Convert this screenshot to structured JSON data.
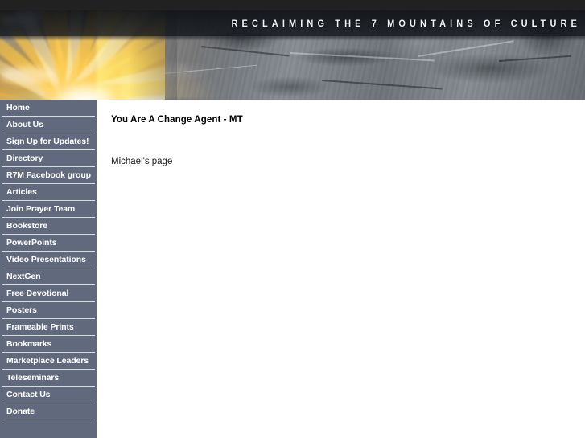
{
  "banner": {
    "headline": "RECLAIMING THE 7 MOUNTAINS OF CULTURE",
    "colors": {
      "topbar": "#212121",
      "rock": "#6d6f75",
      "sun": "#f0a93c",
      "band": "#101419"
    }
  },
  "sidebar": {
    "background_color": "#616a7d",
    "divider_color": "#d8dade",
    "text_color": "#ffffff",
    "items": [
      {
        "label": "Home"
      },
      {
        "label": "About Us"
      },
      {
        "label": "Sign Up for Updates!"
      },
      {
        "label": "Directory"
      },
      {
        "label": "R7M Facebook group"
      },
      {
        "label": "Articles"
      },
      {
        "label": "Join Prayer Team"
      },
      {
        "label": "Bookstore"
      },
      {
        "label": "PowerPoints"
      },
      {
        "label": "Video Presentations"
      },
      {
        "label": "NextGen"
      },
      {
        "label": "Free Devotional"
      },
      {
        "label": "Posters"
      },
      {
        "label": "Frameable Prints"
      },
      {
        "label": "Bookmarks"
      },
      {
        "label": "Marketplace Leaders"
      },
      {
        "label": "Teleseminars"
      },
      {
        "label": "Contact Us"
      },
      {
        "label": "Donate"
      }
    ]
  },
  "main": {
    "title": "You Are A Change Agent - MT",
    "body": "Michael's page"
  }
}
